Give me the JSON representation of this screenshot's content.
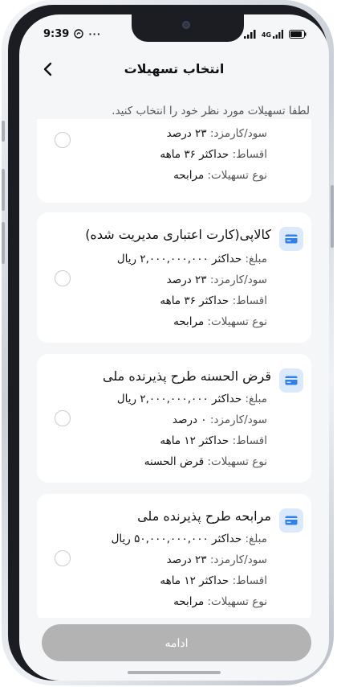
{
  "status_bar": {
    "time": "9:39",
    "right_text": "4G"
  },
  "header": {
    "title": "انتخاب تسهیلات"
  },
  "subtitle": "لطفا تسهیلات مورد نظر خود را انتخاب کنید.",
  "cards": [
    {
      "title": "",
      "rows": [
        {
          "key": "سود/کارمزد:",
          "value": "۲۳ درصد"
        },
        {
          "key": "اقساط:",
          "value": "حداکثر ۳۶ ماهه"
        },
        {
          "key": "نوع تسهیلات:",
          "value": "مرابحه"
        }
      ]
    },
    {
      "title": "کالاپی(کارت اعتباری مدیریت شده)",
      "rows": [
        {
          "key": "مبلغ:",
          "value": "حداکثر ۲,۰۰۰,۰۰۰,۰۰۰ ریال"
        },
        {
          "key": "سود/کارمزد:",
          "value": "۲۳ درصد"
        },
        {
          "key": "اقساط:",
          "value": "حداکثر ۳۶ ماهه"
        },
        {
          "key": "نوع تسهیلات:",
          "value": "مرابحه"
        }
      ]
    },
    {
      "title": "قرض الحسنه طرح پذیرنده ملی",
      "rows": [
        {
          "key": "مبلغ:",
          "value": "حداکثر ۲,۰۰۰,۰۰۰,۰۰۰ ریال"
        },
        {
          "key": "سود/کارمزد:",
          "value": "۰ درصد"
        },
        {
          "key": "اقساط:",
          "value": "حداکثر ۱۲ ماهه"
        },
        {
          "key": "نوع تسهیلات:",
          "value": "قرض الحسنه"
        }
      ]
    },
    {
      "title": "مرابحه طرح پذیرنده ملی",
      "rows": [
        {
          "key": "مبلغ:",
          "value": "حداکثر ۵۰,۰۰۰,۰۰۰,۰۰۰ ریال"
        },
        {
          "key": "سود/کارمزد:",
          "value": "۲۳ درصد"
        },
        {
          "key": "اقساط:",
          "value": "حداکثر ۱۲ ماهه"
        },
        {
          "key": "نوع تسهیلات:",
          "value": "مرابحه"
        }
      ]
    }
  ],
  "continue_label": "ادامه",
  "icons": {
    "back": "chevron-left-icon",
    "card": "credit-card-icon"
  },
  "colors": {
    "icon_bg": "#dbe9fb",
    "icon_fg": "#2f80ed",
    "button_disabled": "#b3b3b3"
  }
}
